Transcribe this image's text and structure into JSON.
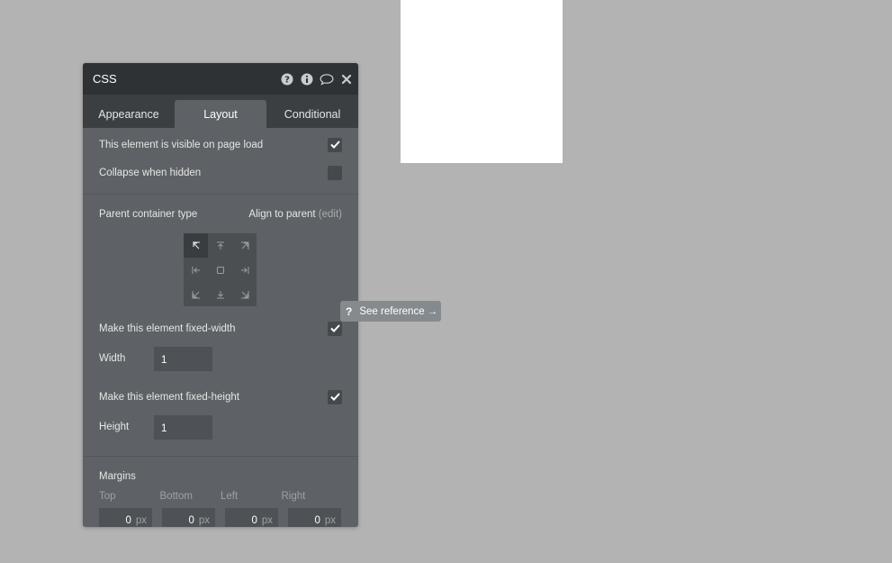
{
  "panel": {
    "title": "CSS"
  },
  "tabs": [
    {
      "label": "Appearance"
    },
    {
      "label": "Layout"
    },
    {
      "label": "Conditional"
    }
  ],
  "visibility": {
    "visible_on_load_label": "This element is visible on page load",
    "visible_on_load_checked": true,
    "collapse_label": "Collapse when hidden",
    "collapse_checked": false
  },
  "parent": {
    "label": "Parent container type",
    "value": "Align to parent",
    "edit_label": "(edit)"
  },
  "fixed_width": {
    "label": "Make this element fixed-width",
    "checked": true,
    "width_label": "Width",
    "width_value": "1"
  },
  "fixed_height": {
    "label": "Make this element fixed-height",
    "checked": true,
    "height_label": "Height",
    "height_value": "1"
  },
  "margins": {
    "title": "Margins",
    "fields": [
      {
        "label": "Top",
        "value": "0",
        "unit": "px"
      },
      {
        "label": "Bottom",
        "value": "0",
        "unit": "px"
      },
      {
        "label": "Left",
        "value": "0",
        "unit": "px"
      },
      {
        "label": "Right",
        "value": "0",
        "unit": "px"
      }
    ]
  },
  "tooltip": {
    "icon": "?",
    "label": "See reference →"
  },
  "colors": {
    "panel_bg": "#5e6266",
    "header_bg": "#2e3235",
    "canvas_bg": "#b3b3b3"
  }
}
